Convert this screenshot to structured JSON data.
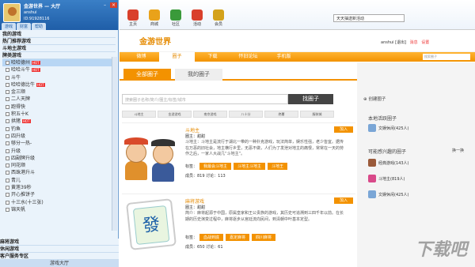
{
  "window": {
    "app_title": "金游世界 — 大厅",
    "username": "anshui",
    "user_id": "ID:91928116",
    "tabs": [
      "游戏",
      "财富",
      "帮助"
    ],
    "min": "–",
    "close": "×"
  },
  "tree": {
    "top_categories": [
      "我的游戏",
      "热门推荐游戏",
      "斗地主游戏",
      "牌类游戏"
    ],
    "items": [
      {
        "label": "哈哈德州",
        "hot": "HOT"
      },
      {
        "label": "哈哈斗牛",
        "hot": "HOT"
      },
      {
        "label": "斗牛",
        "hot": ""
      },
      {
        "label": "哈哈德比牛",
        "hot": "HOT"
      },
      {
        "label": "金三顺",
        "hot": ""
      },
      {
        "label": "二人天牌",
        "hot": ""
      },
      {
        "label": "跑得快",
        "hot": ""
      },
      {
        "label": "积五十K",
        "hot": ""
      },
      {
        "label": "拱猪",
        "hot": "HOT"
      },
      {
        "label": "钓鱼",
        "hot": ""
      },
      {
        "label": "四升级",
        "hot": ""
      },
      {
        "label": "够分一热-",
        "hot": ""
      },
      {
        "label": "升级",
        "hot": ""
      },
      {
        "label": "四副牌升级",
        "hot": ""
      },
      {
        "label": "同花顺",
        "hot": ""
      },
      {
        "label": "西珠港升斗",
        "hot": ""
      },
      {
        "label": "青儿",
        "hot": ""
      },
      {
        "label": "黄莲39秒",
        "hot": ""
      },
      {
        "label": "开心推饼子",
        "hot": ""
      },
      {
        "label": "十三水(十三张)",
        "hot": ""
      },
      {
        "label": "锦天帆",
        "hot": ""
      }
    ],
    "bottom_categories": [
      "麻将游戏",
      "休闲游戏",
      "客户服务专区"
    ],
    "lobby": "游戏大厅"
  },
  "toolbar": {
    "items": [
      {
        "label": "主页",
        "icon": "home-icon",
        "color": "#d9402b"
      },
      {
        "label": "商城",
        "icon": "shop-icon",
        "color": "#e9a21a"
      },
      {
        "label": "社区",
        "icon": "community-icon",
        "color": "#3a9a3a"
      },
      {
        "label": "活动",
        "icon": "event-icon",
        "color": "#d9402b"
      },
      {
        "label": "会员",
        "icon": "member-icon",
        "color": "#d4a21a"
      }
    ],
    "notice": "天天抽送新活动"
  },
  "header": {
    "logo": "金游世界",
    "user": "anshui",
    "logout": "[退出]",
    "msg": "消息",
    "settings": "设置"
  },
  "nav": {
    "items": [
      "微博",
      "圈子",
      "下载",
      "怀旧论坛",
      "手机版"
    ],
    "active": 1,
    "search_placeholder": "搜索圈子"
  },
  "subtabs": {
    "all": "全部圈子",
    "mine": "我的圈子"
  },
  "search": {
    "placeholder": "搜索圈子名称/简介/圈主/标签/城市",
    "button": "找圈子"
  },
  "filter_tags": [
    "斗地主",
    "金游游戏",
    "南京游戏",
    "八十分",
    "绝薯",
    "服装城"
  ],
  "groups": [
    {
      "title": "斗地主",
      "join": "加入",
      "owner": "圈主：甜甜",
      "desc": "斗地主：斗地主是流行于湖北一带的一种扑克游戏，玩法简单，娱乐性强，老少皆宜。据传在万恶的旧社会，地主横行乡里，无恶不做，人们为了发泄对地主的痛恨，常常在一天的劳作之后，一家人大战几“斗地主”。",
      "tags_label": "标签：",
      "tags": [
        "我最会斗地主",
        "斗地主斗地主",
        "斗地王"
      ],
      "stats": "成员：819    讨论：113"
    },
    {
      "title": "麻将游戏",
      "join": "加入",
      "owner": "圈主：甜甜",
      "desc": "简介：麻将起源于中国，原属皇家和王公贵族的游戏，其历史可追溯到三四千年以前。在长期的历史演变过程中，麻将逐步从宫廷流向民间，到清朝中叶基本定型。",
      "tags_label": "标签：",
      "tags": [
        "血战到底",
        "嘉定麻将",
        "四川麻将"
      ],
      "stats": "成员：650    讨论：61"
    }
  ],
  "side": {
    "create": "创建圈子",
    "active_title": "本地活跃圈子",
    "active": [
      {
        "name": "文娱休闲(425人)",
        "color": "#7aa6d6"
      }
    ],
    "interest_title": "可能感兴趣的圈子",
    "refresh": "换一换",
    "interest": [
      {
        "name": "经典游戏(143人)",
        "color": "#9a5a3a"
      },
      {
        "name": "斗地主(819人)",
        "color": "#d94a8a"
      },
      {
        "name": "文娱休闲(425人)",
        "color": "#7aa6d6"
      }
    ]
  },
  "watermark": "下载吧"
}
